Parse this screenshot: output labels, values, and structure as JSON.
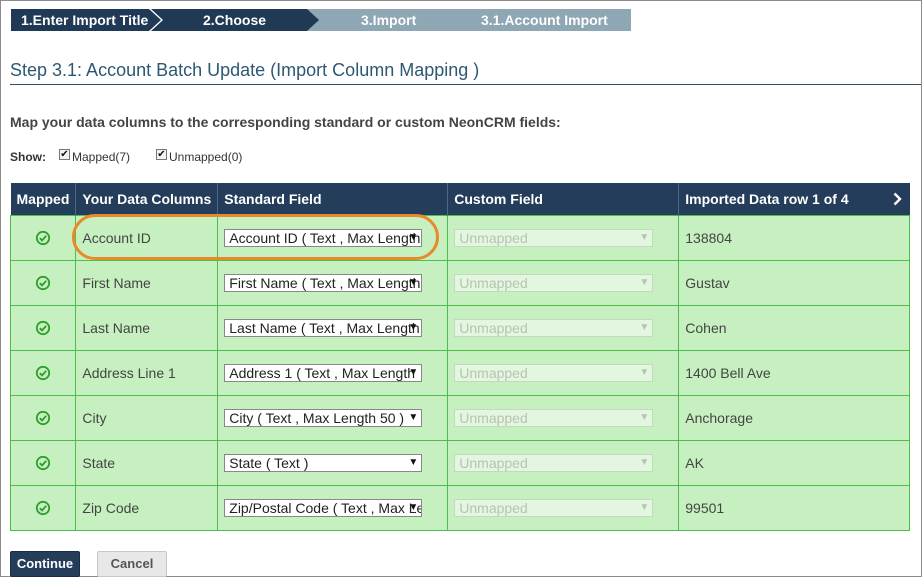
{
  "wizard": {
    "steps": [
      {
        "label": "1.Enter Import Title"
      },
      {
        "label": "2.Choose"
      },
      {
        "label": "3.Import"
      },
      {
        "label": "3.1.Account Import"
      }
    ]
  },
  "page": {
    "title": "Step 3.1: Account Batch Update (Import Column Mapping )",
    "instructions": "Map your data columns to the corresponding standard or custom NeonCRM fields:"
  },
  "show": {
    "label": "Show:",
    "mapped_label": "Mapped(7)",
    "unmapped_label": "Unmapped(0)"
  },
  "table": {
    "headers": {
      "mapped": "Mapped",
      "data_columns": "Your Data Columns",
      "standard_field": "Standard Field",
      "custom_field": "Custom Field",
      "imported_row": "Imported Data row 1 of 4"
    },
    "rows": [
      {
        "column": "Account ID",
        "standard": "Account ID ( Text , Max Length",
        "custom": "Unmapped",
        "value": "138804"
      },
      {
        "column": "First Name",
        "standard": "First Name ( Text , Max Length",
        "custom": "Unmapped",
        "value": "Gustav"
      },
      {
        "column": "Last Name",
        "standard": "Last Name ( Text , Max Length",
        "custom": "Unmapped",
        "value": "Cohen"
      },
      {
        "column": "Address Line 1",
        "standard": "Address 1 ( Text , Max Length",
        "custom": "Unmapped",
        "value": "1400 Bell Ave"
      },
      {
        "column": "City",
        "standard": "City ( Text , Max Length 50 )",
        "custom": "Unmapped",
        "value": "Anchorage"
      },
      {
        "column": "State",
        "standard": "State ( Text )",
        "custom": "Unmapped",
        "value": "AK"
      },
      {
        "column": "Zip Code",
        "standard": "Zip/Postal Code ( Text , Max Le",
        "custom": "Unmapped",
        "value": "99501"
      }
    ]
  },
  "buttons": {
    "continue": "Continue",
    "cancel": "Cancel"
  },
  "colors": {
    "header_bg": "#243d5a",
    "row_bg": "#c7f0c0",
    "row_border": "#4bbf4a",
    "check_green": "#2e9e2e",
    "highlight": "#e98a2a"
  }
}
